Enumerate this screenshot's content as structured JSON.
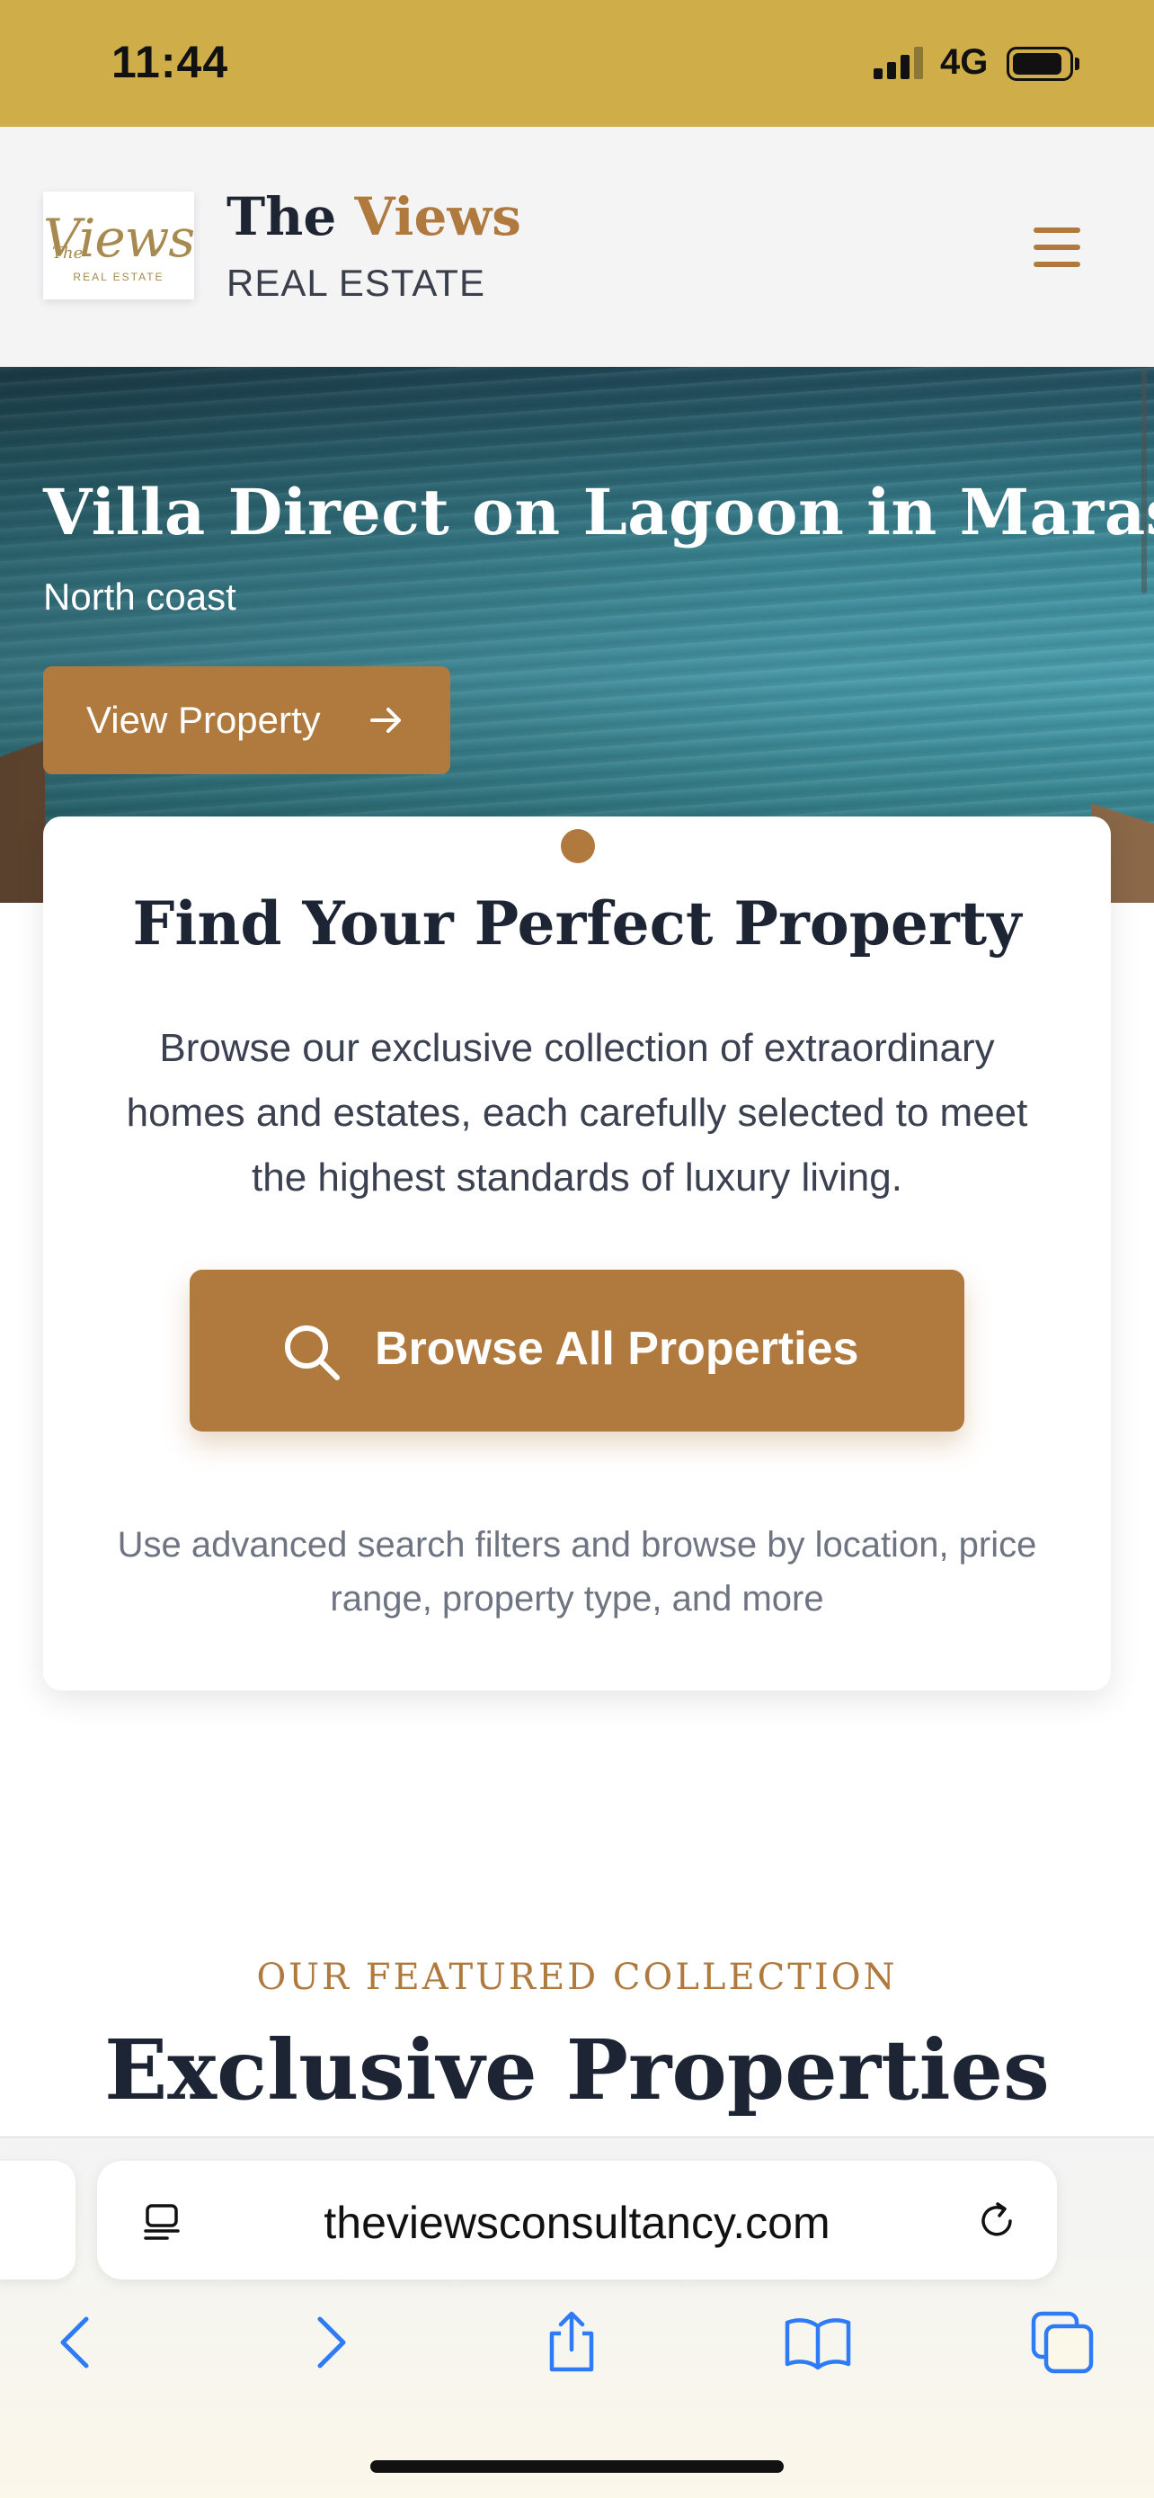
{
  "status_bar": {
    "time": "11:44",
    "network": "4G"
  },
  "header": {
    "logo_script": "Views",
    "logo_the": "The",
    "logo_sub": "REAL ESTATE",
    "brand_the": "The",
    "brand_views": "Views",
    "brand_sub": "REAL ESTATE",
    "menu_icon": "hamburger-menu-icon"
  },
  "hero": {
    "title": "Villa Direct on Lagoon in Marassi",
    "subtitle": "North coast",
    "button_label": "View Property",
    "button_icon": "arrow-right-icon"
  },
  "card": {
    "title": "Find Your Perfect Property",
    "description": "Browse our exclusive collection of extraordinary homes and estates, each carefully selected to meet the highest standards of luxury living.",
    "button_label": "Browse All Properties",
    "button_icon": "search-icon",
    "note": "Use advanced search filters and browse by location, price range, property type, and more"
  },
  "featured": {
    "eyebrow": "OUR FEATURED COLLECTION",
    "title": "Exclusive Properties"
  },
  "browser": {
    "url": "theviewsconsultancy.com",
    "icons": [
      "reader-icon",
      "reload-icon",
      "back-icon",
      "forward-icon",
      "share-icon",
      "bookmarks-icon",
      "tabs-icon"
    ]
  },
  "colors": {
    "status_bar": "#cfae4a",
    "accent": "#b07a3f",
    "heading": "#1d2433"
  }
}
